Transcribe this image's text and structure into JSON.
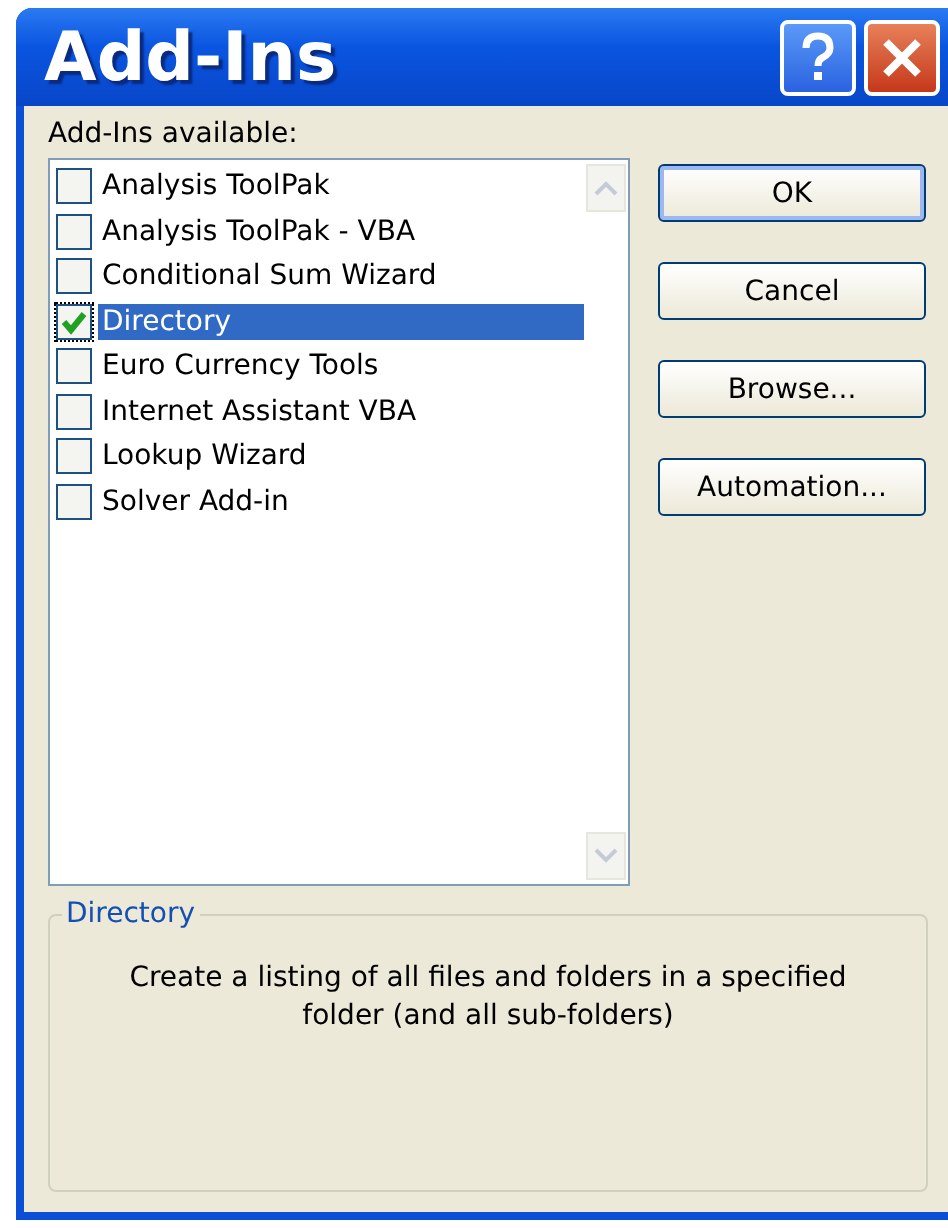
{
  "window": {
    "title": "Add-Ins"
  },
  "list": {
    "label": "Add-Ins available:",
    "items": [
      {
        "label": "Analysis ToolPak",
        "checked": false,
        "selected": false
      },
      {
        "label": "Analysis ToolPak - VBA",
        "checked": false,
        "selected": false
      },
      {
        "label": "Conditional Sum Wizard",
        "checked": false,
        "selected": false
      },
      {
        "label": "Directory",
        "checked": true,
        "selected": true
      },
      {
        "label": "Euro Currency Tools",
        "checked": false,
        "selected": false
      },
      {
        "label": "Internet Assistant VBA",
        "checked": false,
        "selected": false
      },
      {
        "label": "Lookup Wizard",
        "checked": false,
        "selected": false
      },
      {
        "label": "Solver Add-in",
        "checked": false,
        "selected": false
      }
    ]
  },
  "buttons": [
    {
      "label": "OK",
      "default": true
    },
    {
      "label": "Cancel",
      "default": false
    },
    {
      "label": "Browse...",
      "default": false
    },
    {
      "label": "Automation...",
      "default": false
    }
  ],
  "description": {
    "title": "Directory",
    "text": "Create a listing of all files and folders in a specified folder (and all sub-folders)"
  }
}
